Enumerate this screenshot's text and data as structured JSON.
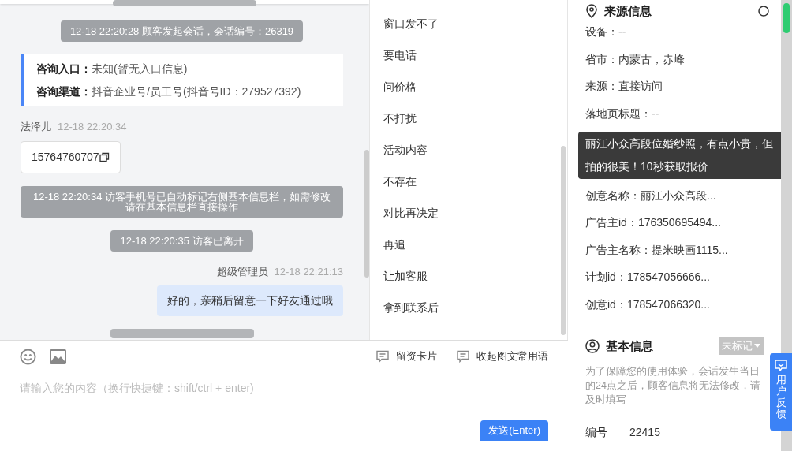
{
  "chat": {
    "messages": [
      {
        "kind": "stub"
      },
      {
        "kind": "system",
        "text": "12-18 22:20:28 顾客发起会话，会话编号：26319"
      },
      {
        "kind": "info",
        "lines": [
          {
            "label": "咨询入口：",
            "value": "未知(暂无入口信息)"
          },
          {
            "label": "咨询渠道：",
            "value": "抖音企业号/员工号(抖音号ID：279527392)"
          }
        ]
      },
      {
        "kind": "visitor",
        "name": "法泽儿",
        "time": "12-18 22:20:34",
        "text": "15764760707"
      },
      {
        "kind": "system",
        "text": "12-18 22:20:34 访客手机号已自动标记右侧基本信息栏，如需修改请在基本信息栏直接操作"
      },
      {
        "kind": "system",
        "text": "12-18 22:20:35 访客已离开"
      },
      {
        "kind": "agent",
        "name": "超级管理员",
        "time": "12-18 22:21:13",
        "text": "好的，亲稍后留意一下好友通过哦"
      },
      {
        "kind": "stub"
      }
    ]
  },
  "quick_replies": [
    "窗口发不了",
    "要电话",
    "问价格",
    "不打扰",
    "活动内容",
    "不存在",
    "对比再决定",
    "再追",
    "让加客服",
    "拿到联系后"
  ],
  "composer": {
    "tools": [
      "留资卡片",
      "收起图文常用语"
    ],
    "placeholder": "请输入您的内容（换行快捷键：shift/ctrl + enter)",
    "send": "发送(Enter)"
  },
  "source_info": {
    "title": "来源信息",
    "fields": [
      {
        "kind": "field",
        "text": "设备：--"
      },
      {
        "kind": "field",
        "text": "省市：内蒙古，赤峰"
      },
      {
        "kind": "field",
        "text": "来源：直接访问"
      },
      {
        "kind": "field",
        "text": "落地页标题：--"
      },
      {
        "kind": "hidden"
      },
      {
        "kind": "hidden"
      },
      {
        "kind": "field",
        "text": "创意名称：丽江小众高段..."
      },
      {
        "kind": "field",
        "text": "广告主id：176350695494..."
      },
      {
        "kind": "field",
        "text": "广告主名称：提米映画1115..."
      },
      {
        "kind": "field",
        "text": "计划id：178547056666..."
      },
      {
        "kind": "field",
        "text": "创意id：178547066320..."
      }
    ],
    "tooltip": "丽江小众高段位婚纱照，有点小贵，但拍的很美！10秒获取报价"
  },
  "basic_info": {
    "title": "基本信息",
    "tag": "未标记",
    "note": "为了保障您的使用体验，会话发生当日的24点之后，顾客信息将无法修改，请及时填写",
    "id_label": "编号",
    "id_value": "22415"
  },
  "feedback": "用户反馈"
}
